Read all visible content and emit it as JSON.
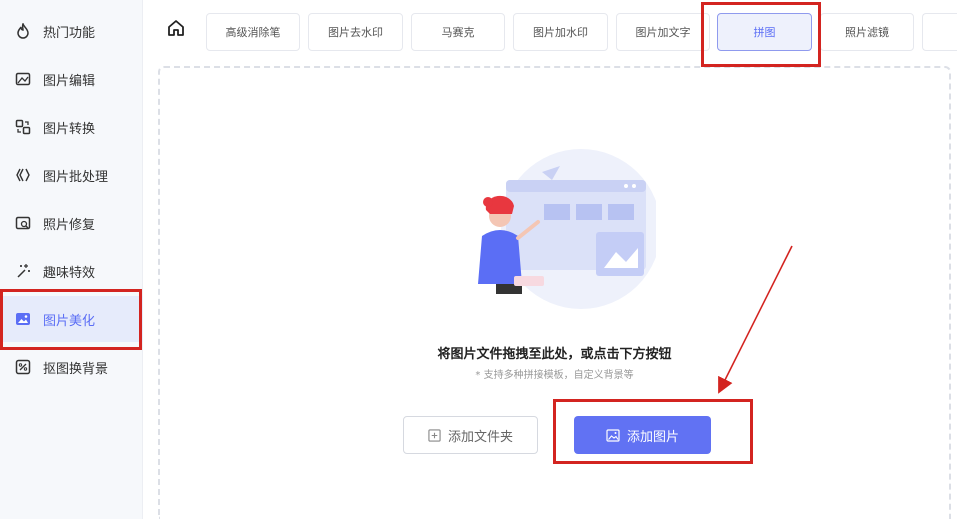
{
  "sidebar": {
    "items": [
      {
        "label": "热门功能",
        "icon": "flame-icon"
      },
      {
        "label": "图片编辑",
        "icon": "image-edit-icon"
      },
      {
        "label": "图片转换",
        "icon": "convert-icon"
      },
      {
        "label": "图片批处理",
        "icon": "batch-icon"
      },
      {
        "label": "照片修复",
        "icon": "photo-repair-icon"
      },
      {
        "label": "趣味特效",
        "icon": "sparkle-icon"
      },
      {
        "label": "图片美化",
        "icon": "beautify-icon"
      },
      {
        "label": "抠图换背景",
        "icon": "cutout-icon"
      }
    ],
    "active_index": 6
  },
  "topbar": {
    "home_icon": "home-icon",
    "tabs": [
      "高级消除笔",
      "图片去水印",
      "马赛克",
      "图片加水印",
      "图片加文字",
      "拼图",
      "照片滤镜"
    ],
    "active_index": 5
  },
  "upload": {
    "title": "将图片文件拖拽至此处，或点击下方按钮",
    "subtitle": "* 支持多种拼接模板，自定义背景等",
    "add_folder_label": "添加文件夹",
    "add_image_label": "添加图片"
  },
  "colors": {
    "accent": "#6172f3",
    "annotation": "#d32420",
    "sidebar_bg": "#f6f8fb"
  }
}
